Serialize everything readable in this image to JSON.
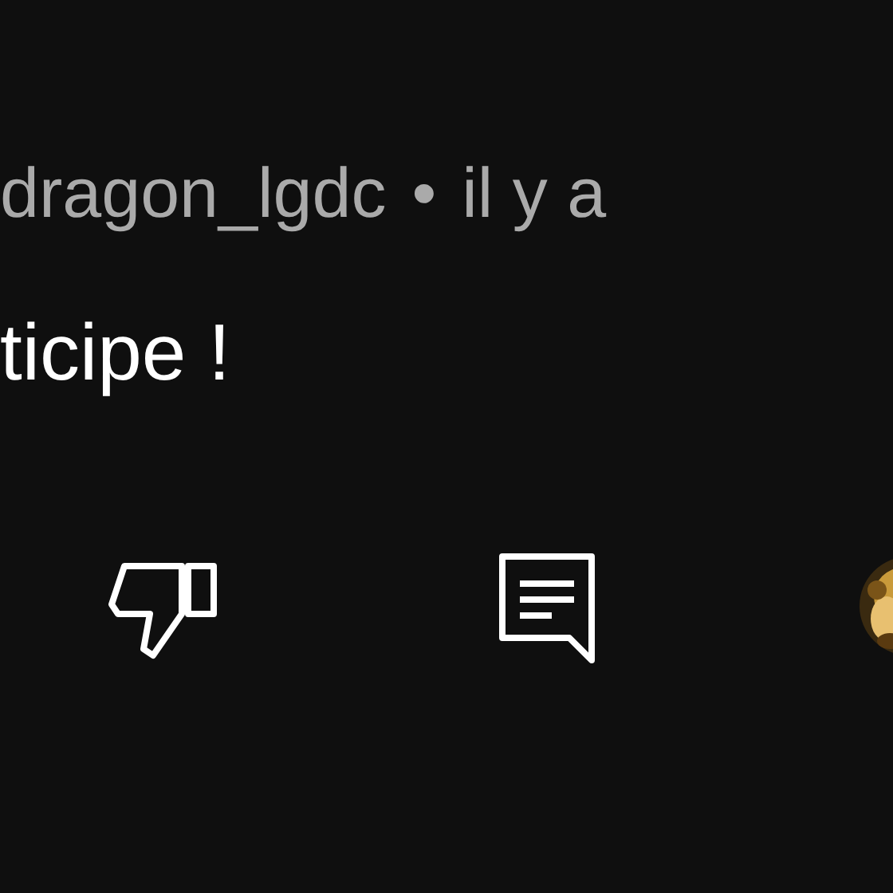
{
  "comment": {
    "author": "dragon_lgdc",
    "separator": "•",
    "time": "il y a",
    "text": "ticipe !"
  },
  "actions": [
    {
      "kind": "dislike"
    },
    {
      "kind": "reply"
    }
  ]
}
